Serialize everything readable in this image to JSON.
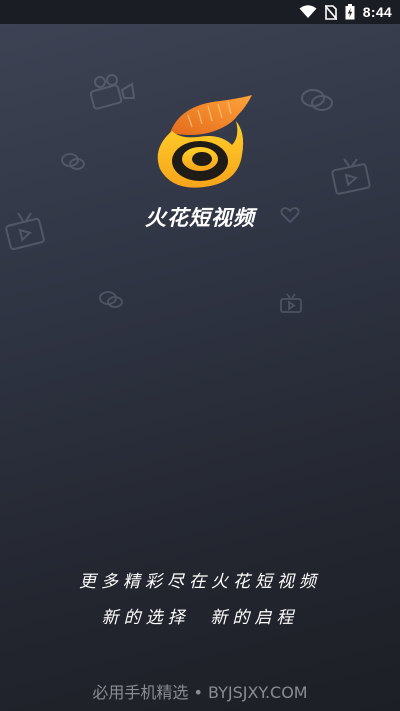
{
  "status_bar": {
    "time": "8:44",
    "icons": [
      "wifi-icon",
      "no-sim-icon",
      "battery-charging-icon"
    ]
  },
  "app": {
    "name": "火花短视频"
  },
  "slogans": {
    "line1": "更多精彩尽在火花短视频",
    "line2": "新的选择  新的启程"
  },
  "footer": {
    "text": "必用手机精选 • BYJSJXY.COM"
  },
  "colors": {
    "logo_orange": "#f29a2e",
    "logo_yellow": "#ffc21f",
    "background_top": "#3e4455",
    "background_bottom": "#1d1f26"
  },
  "background_icons": [
    "camera-icon",
    "chat-bubble-icon",
    "tv-icon",
    "heart-icon"
  ]
}
